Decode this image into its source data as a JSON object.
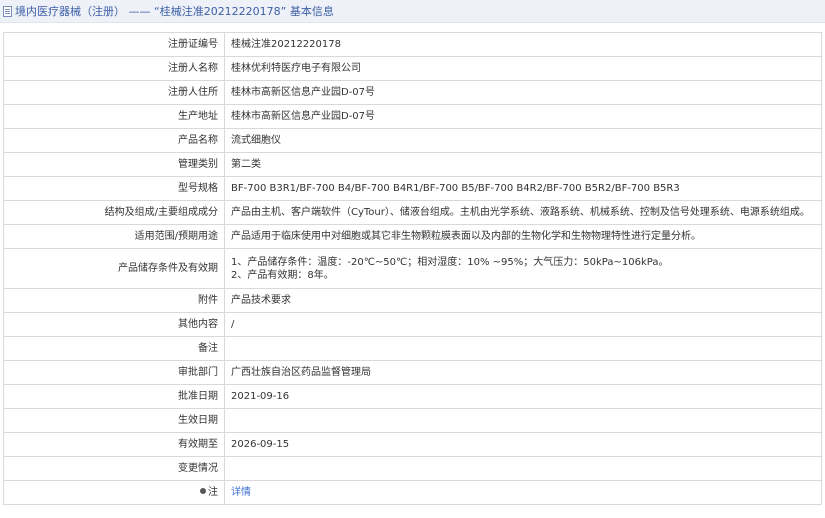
{
  "header": {
    "title": "境内医疗器械（注册） —— “桂械注准20212220178” 基本信息"
  },
  "rows": [
    {
      "label": "注册证编号",
      "value": "桂械注准20212220178"
    },
    {
      "label": "注册人名称",
      "value": "桂林优利特医疗电子有限公司"
    },
    {
      "label": "注册人住所",
      "value": "桂林市高新区信息产业园D-07号"
    },
    {
      "label": "生产地址",
      "value": "桂林市高新区信息产业园D-07号"
    },
    {
      "label": "产品名称",
      "value": "流式细胞仪"
    },
    {
      "label": "管理类别",
      "value": "第二类"
    },
    {
      "label": "型号规格",
      "value": "BF-700 B3R1/BF-700 B4/BF-700 B4R1/BF-700 B5/BF-700 B4R2/BF-700 B5R2/BF-700 B5R3"
    },
    {
      "label": "结构及组成/主要组成成分",
      "value": "产品由主机、客户端软件（CyTour）、储液台组成。主机由光学系统、液路系统、机械系统、控制及信号处理系统、电源系统组成。"
    },
    {
      "label": "适用范围/预期用途",
      "value": "产品适用于临床使用中对细胞或其它非生物颗粒膜表面以及内部的生物化学和生物物理特性进行定量分析。"
    },
    {
      "label": "产品储存条件及有效期",
      "value_line1": "1、产品储存条件：温度：-20℃~50℃；相对湿度：10% ~95%；大气压力：50kPa~106kPa。",
      "value_line2": "2、产品有效期：8年。"
    },
    {
      "label": "附件",
      "value": "产品技术要求"
    },
    {
      "label": "其他内容",
      "value": "/"
    },
    {
      "label": "备注",
      "value": ""
    },
    {
      "label": "审批部门",
      "value": "广西壮族自治区药品监督管理局"
    },
    {
      "label": "批准日期",
      "value": "2021-09-16"
    },
    {
      "label": "生效日期",
      "value": ""
    },
    {
      "label": "有效期至",
      "value": "2026-09-15"
    },
    {
      "label": "变更情况",
      "value": ""
    },
    {
      "label": "注",
      "value": "详情"
    }
  ],
  "colors": {
    "header_bg": "#eef1f7",
    "header_text": "#3c5fa6",
    "link": "#3c6fd1",
    "border": "#d9d9d9"
  }
}
